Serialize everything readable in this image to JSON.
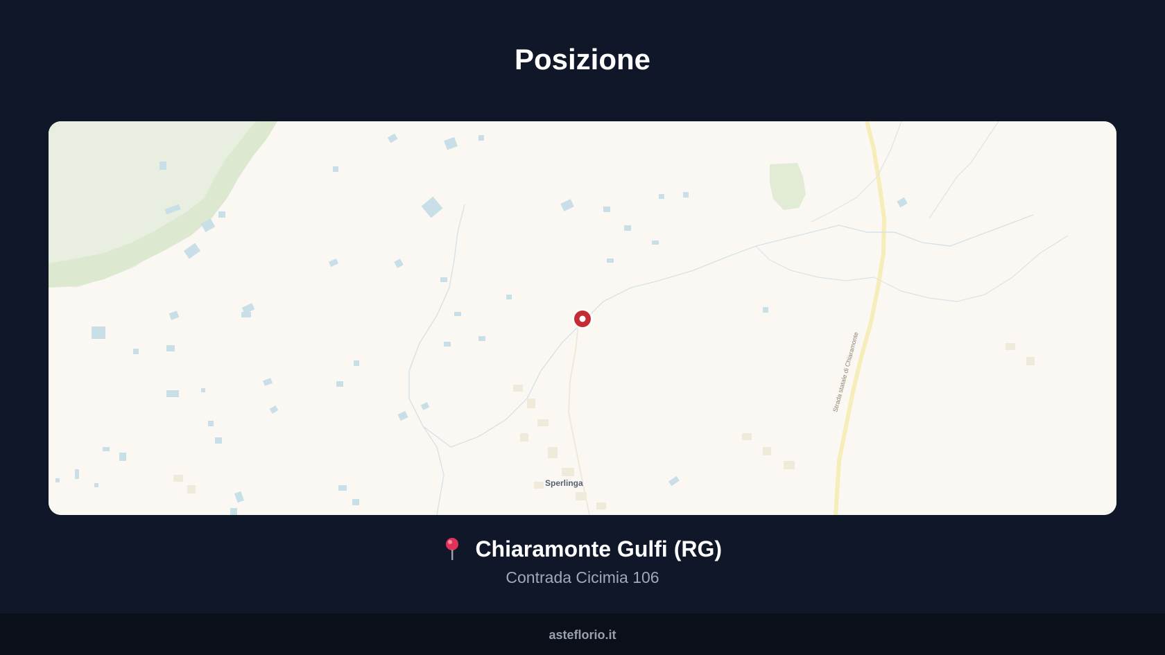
{
  "header": {
    "title": "Posizione"
  },
  "map": {
    "town_label": "Sperlinga",
    "road_label": "Strada statale di Chiaramonte",
    "marker_icon": "map-marker-icon",
    "colors": {
      "land": "#fbf8f3",
      "vegetation": "#dfe9d2",
      "water": "#c7dde6",
      "road": "#f4eab2",
      "marker": "#c42d35"
    }
  },
  "location": {
    "icon": "pin-icon",
    "city": "Chiaramonte Gulfi (RG)",
    "address": "Contrada Cicimia 106"
  },
  "footer": {
    "site": "asteflorio.it"
  },
  "colors": {
    "background": "#0f1728",
    "footer_background": "#0a0f19"
  }
}
